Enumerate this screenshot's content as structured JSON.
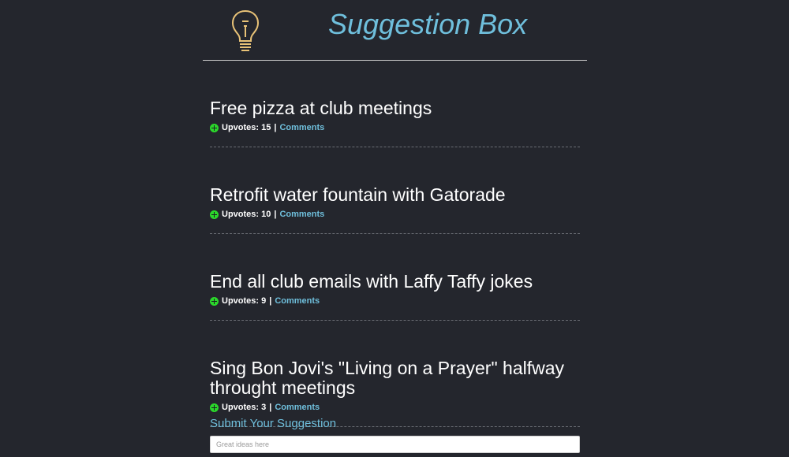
{
  "header": {
    "title": "Suggestion Box",
    "logo_icon": "lightbulb-icon",
    "logo_color": "#e8c277",
    "title_color": "#6fbfdc"
  },
  "suggestions": [
    {
      "title": "Free pizza at club meetings",
      "upvotes_text": "Upvotes: 15",
      "separator": "|",
      "comments_label": "Comments"
    },
    {
      "title": "Retrofit water fountain with Gatorade",
      "upvotes_text": "Upvotes: 10",
      "separator": "|",
      "comments_label": "Comments"
    },
    {
      "title": "End all club emails with Laffy Taffy jokes",
      "upvotes_text": "Upvotes: 9",
      "separator": "|",
      "comments_label": "Comments"
    },
    {
      "title": "Sing Bon Jovi's \"Living on a Prayer\" halfway throught meetings",
      "upvotes_text": "Upvotes: 3",
      "separator": "|",
      "comments_label": "Comments"
    }
  ],
  "upvote_icon": "plus-circle-icon",
  "upvote_color": "#2bd82b",
  "form": {
    "heading": "Submit Your Suggestion",
    "input_placeholder": "Great ideas here",
    "input_value": ""
  }
}
